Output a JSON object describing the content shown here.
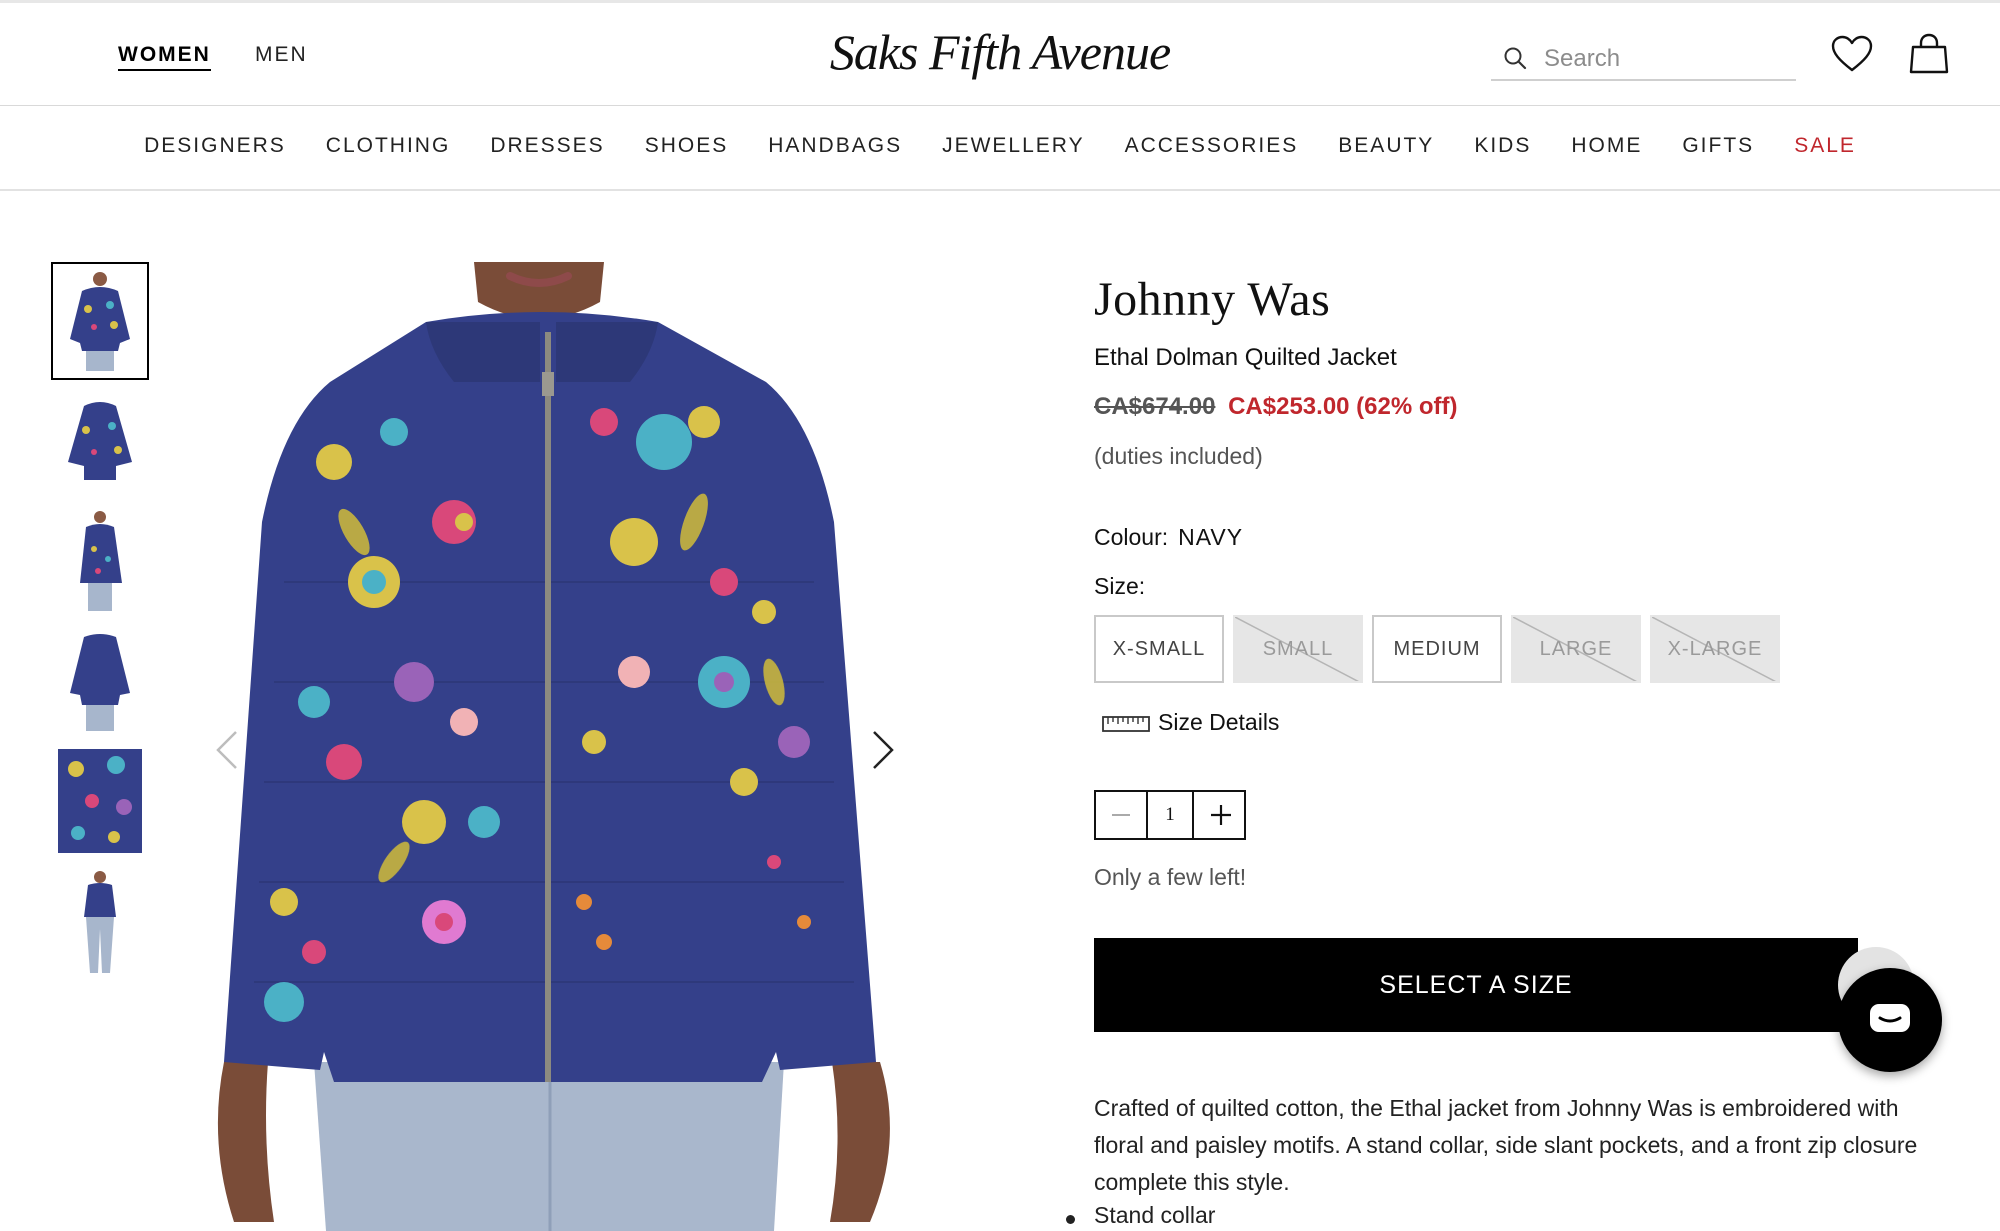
{
  "header": {
    "gender_tabs": [
      {
        "label": "WOMEN",
        "active": true
      },
      {
        "label": "MEN",
        "active": false
      }
    ],
    "logo_text": "Saks Fifth Avenue",
    "search_placeholder": "Search",
    "icons": [
      "search-icon",
      "heart-icon",
      "bag-icon"
    ]
  },
  "nav": {
    "items": [
      "DESIGNERS",
      "CLOTHING",
      "DRESSES",
      "SHOES",
      "HANDBAGS",
      "JEWELLERY",
      "ACCESSORIES",
      "BEAUTY",
      "KIDS",
      "HOME",
      "GIFTS",
      "SALE"
    ],
    "sale_color": "#c0272d"
  },
  "gallery": {
    "thumbnail_count": 6,
    "selected_index": 0,
    "jacket_color": "#34408a"
  },
  "product": {
    "brand": "Johnny Was",
    "name": "Ethal Dolman Quilted Jacket",
    "original_price": "CA$674.00",
    "sale_price": "CA$253.00 (62% off)",
    "duties_note": "(duties included)",
    "colour_label": "Colour:",
    "colour_value": "NAVY",
    "size_label": "Size:",
    "sizes": [
      {
        "label": "X-SMALL",
        "available": true
      },
      {
        "label": "SMALL",
        "available": false
      },
      {
        "label": "MEDIUM",
        "available": true
      },
      {
        "label": "LARGE",
        "available": false
      },
      {
        "label": "X-LARGE",
        "available": false
      }
    ],
    "size_details_label": "Size Details",
    "quantity": "1",
    "stock_note": "Only a few left!",
    "cta_label": "SELECT A SIZE",
    "description": "Crafted of quilted cotton, the Ethal jacket from Johnny Was is embroidered with floral and paisley motifs. A stand collar, side slant pockets, and a front zip closure complete this style.",
    "bullets": [
      "Stand collar"
    ]
  },
  "colors": {
    "sale_red": "#c0272d",
    "cta_bg": "#000000"
  }
}
